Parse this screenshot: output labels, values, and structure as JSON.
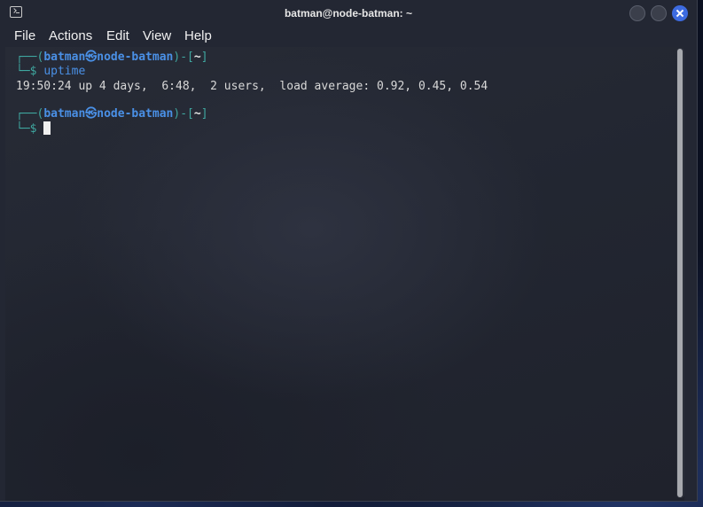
{
  "window": {
    "title": "batman@node-batman: ~",
    "close_color": "#3d6be0"
  },
  "menu": {
    "file": "File",
    "actions": "Actions",
    "edit": "Edit",
    "view": "View",
    "help": "Help"
  },
  "terminal": {
    "prompt1": {
      "bracket_open": "┌──(",
      "user_host": "batman㉿node-batman",
      "sep": ")-[",
      "dir": "~",
      "bracket_close": "]",
      "dollar_line": "└─$",
      "command": "uptime"
    },
    "output": "19:50:24 up 4 days,  6:48,  2 users,  load average: 0.92, 0.45, 0.54",
    "prompt2": {
      "bracket_open": "┌──(",
      "user_host": "batman㉿node-batman",
      "sep": ")-[",
      "dir": "~",
      "bracket_close": "]",
      "dollar_line": "└─$"
    }
  }
}
